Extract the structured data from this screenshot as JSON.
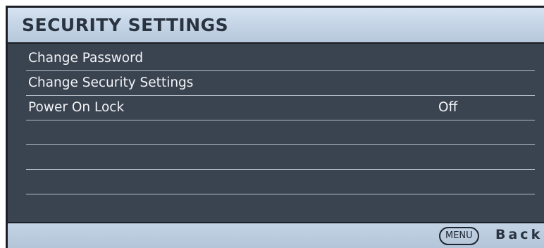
{
  "header": {
    "title": "SECURITY SETTINGS"
  },
  "menu": {
    "items": [
      {
        "label": "Change Password",
        "value": ""
      },
      {
        "label": "Change Security Settings",
        "value": ""
      },
      {
        "label": "Power On Lock",
        "value": "Off"
      },
      {
        "label": "",
        "value": ""
      },
      {
        "label": "",
        "value": ""
      },
      {
        "label": "",
        "value": ""
      }
    ]
  },
  "footer": {
    "menu_key_label": "MENU",
    "back_label": "Back"
  },
  "colors": {
    "panel_background": "#3a4350",
    "header_background": "#c3d3e5",
    "text": "#f2f4f6",
    "divider": "#b6bdc6"
  }
}
